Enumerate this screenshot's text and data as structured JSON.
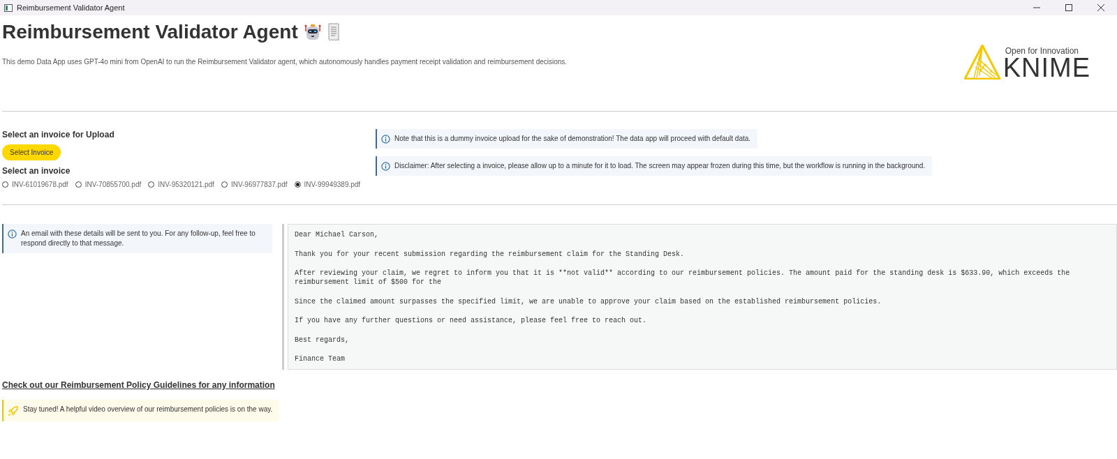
{
  "window": {
    "title": "Reimbursement Validator Agent"
  },
  "header": {
    "title": "Reimbursement Validator Agent",
    "description": "This demo Data App uses GPT-4o mini from OpenAI to run the Reimbursement Validator agent, which autonomously handles payment receipt validation and reimbursement decisions.",
    "logo": {
      "tagline": "Open for Innovation",
      "wordmark": "KNIME"
    }
  },
  "upload": {
    "heading": "Select an invoice for Upload",
    "button": "Select Invoice"
  },
  "invoice_choice": {
    "heading": "Select an invoice",
    "options": [
      {
        "label": "INV-61019678.pdf",
        "selected": false
      },
      {
        "label": "INV-70855700.pdf",
        "selected": false
      },
      {
        "label": "INV-95320121.pdf",
        "selected": false
      },
      {
        "label": "INV-96977837.pdf",
        "selected": false
      },
      {
        "label": "INV-99949389.pdf",
        "selected": true
      }
    ]
  },
  "notes": [
    {
      "kind": "info",
      "text": "Note that this is a dummy invoice upload for the sake of demonstration! The data app will proceed with default data."
    },
    {
      "kind": "info",
      "text": "Disclaimer: After selecting a invoice, please allow up to a minute for it to load. The screen may appear frozen during this time, but the workflow is running in the background."
    }
  ],
  "email_note": {
    "kind": "info",
    "text": "An email with these details will be sent to you. For any follow-up, feel free to respond directly to that message."
  },
  "email_lines": [
    "Dear Michael Carson,",
    "Thank you for your recent submission regarding the reimbursement claim for the Standing Desk.",
    "After reviewing your claim, we regret to inform you that it is **not valid** according to our reimbursement policies. The amount paid for the standing desk is $633.90, which exceeds the reimbursement limit of $500 for the",
    "Since the claimed amount surpasses the specified limit, we are unable to approve your claim based on the established reimbursement policies.",
    "If you have any further questions or need assistance, please feel free to reach out.",
    "Best regards,",
    "Finance Team"
  ],
  "policy_link": "Check out our Reimbursement Policy Guidelines for any information",
  "tip": {
    "kind": "rocket",
    "text": "Stay tuned! A helpful video overview of our reimbursement policies is on the way."
  }
}
